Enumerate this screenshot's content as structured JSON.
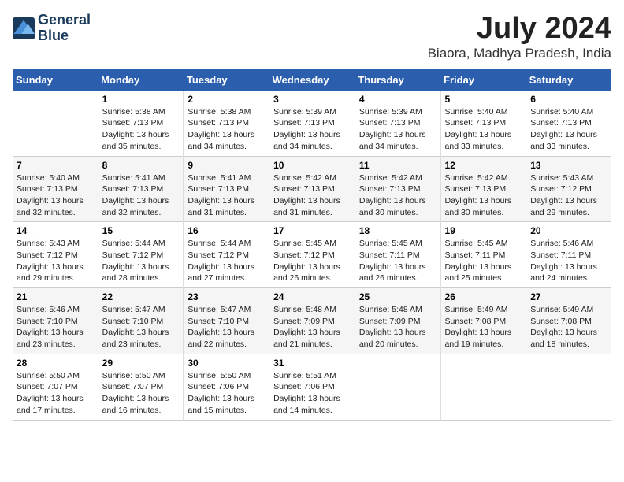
{
  "header": {
    "logo_line1": "General",
    "logo_line2": "Blue",
    "month_year": "July 2024",
    "location": "Biaora, Madhya Pradesh, India"
  },
  "weekdays": [
    "Sunday",
    "Monday",
    "Tuesday",
    "Wednesday",
    "Thursday",
    "Friday",
    "Saturday"
  ],
  "weeks": [
    [
      {
        "day": "",
        "info": ""
      },
      {
        "day": "1",
        "info": "Sunrise: 5:38 AM\nSunset: 7:13 PM\nDaylight: 13 hours\nand 35 minutes."
      },
      {
        "day": "2",
        "info": "Sunrise: 5:38 AM\nSunset: 7:13 PM\nDaylight: 13 hours\nand 34 minutes."
      },
      {
        "day": "3",
        "info": "Sunrise: 5:39 AM\nSunset: 7:13 PM\nDaylight: 13 hours\nand 34 minutes."
      },
      {
        "day": "4",
        "info": "Sunrise: 5:39 AM\nSunset: 7:13 PM\nDaylight: 13 hours\nand 34 minutes."
      },
      {
        "day": "5",
        "info": "Sunrise: 5:40 AM\nSunset: 7:13 PM\nDaylight: 13 hours\nand 33 minutes."
      },
      {
        "day": "6",
        "info": "Sunrise: 5:40 AM\nSunset: 7:13 PM\nDaylight: 13 hours\nand 33 minutes."
      }
    ],
    [
      {
        "day": "7",
        "info": "Sunrise: 5:40 AM\nSunset: 7:13 PM\nDaylight: 13 hours\nand 32 minutes."
      },
      {
        "day": "8",
        "info": "Sunrise: 5:41 AM\nSunset: 7:13 PM\nDaylight: 13 hours\nand 32 minutes."
      },
      {
        "day": "9",
        "info": "Sunrise: 5:41 AM\nSunset: 7:13 PM\nDaylight: 13 hours\nand 31 minutes."
      },
      {
        "day": "10",
        "info": "Sunrise: 5:42 AM\nSunset: 7:13 PM\nDaylight: 13 hours\nand 31 minutes."
      },
      {
        "day": "11",
        "info": "Sunrise: 5:42 AM\nSunset: 7:13 PM\nDaylight: 13 hours\nand 30 minutes."
      },
      {
        "day": "12",
        "info": "Sunrise: 5:42 AM\nSunset: 7:13 PM\nDaylight: 13 hours\nand 30 minutes."
      },
      {
        "day": "13",
        "info": "Sunrise: 5:43 AM\nSunset: 7:12 PM\nDaylight: 13 hours\nand 29 minutes."
      }
    ],
    [
      {
        "day": "14",
        "info": "Sunrise: 5:43 AM\nSunset: 7:12 PM\nDaylight: 13 hours\nand 29 minutes."
      },
      {
        "day": "15",
        "info": "Sunrise: 5:44 AM\nSunset: 7:12 PM\nDaylight: 13 hours\nand 28 minutes."
      },
      {
        "day": "16",
        "info": "Sunrise: 5:44 AM\nSunset: 7:12 PM\nDaylight: 13 hours\nand 27 minutes."
      },
      {
        "day": "17",
        "info": "Sunrise: 5:45 AM\nSunset: 7:12 PM\nDaylight: 13 hours\nand 26 minutes."
      },
      {
        "day": "18",
        "info": "Sunrise: 5:45 AM\nSunset: 7:11 PM\nDaylight: 13 hours\nand 26 minutes."
      },
      {
        "day": "19",
        "info": "Sunrise: 5:45 AM\nSunset: 7:11 PM\nDaylight: 13 hours\nand 25 minutes."
      },
      {
        "day": "20",
        "info": "Sunrise: 5:46 AM\nSunset: 7:11 PM\nDaylight: 13 hours\nand 24 minutes."
      }
    ],
    [
      {
        "day": "21",
        "info": "Sunrise: 5:46 AM\nSunset: 7:10 PM\nDaylight: 13 hours\nand 23 minutes."
      },
      {
        "day": "22",
        "info": "Sunrise: 5:47 AM\nSunset: 7:10 PM\nDaylight: 13 hours\nand 23 minutes."
      },
      {
        "day": "23",
        "info": "Sunrise: 5:47 AM\nSunset: 7:10 PM\nDaylight: 13 hours\nand 22 minutes."
      },
      {
        "day": "24",
        "info": "Sunrise: 5:48 AM\nSunset: 7:09 PM\nDaylight: 13 hours\nand 21 minutes."
      },
      {
        "day": "25",
        "info": "Sunrise: 5:48 AM\nSunset: 7:09 PM\nDaylight: 13 hours\nand 20 minutes."
      },
      {
        "day": "26",
        "info": "Sunrise: 5:49 AM\nSunset: 7:08 PM\nDaylight: 13 hours\nand 19 minutes."
      },
      {
        "day": "27",
        "info": "Sunrise: 5:49 AM\nSunset: 7:08 PM\nDaylight: 13 hours\nand 18 minutes."
      }
    ],
    [
      {
        "day": "28",
        "info": "Sunrise: 5:50 AM\nSunset: 7:07 PM\nDaylight: 13 hours\nand 17 minutes."
      },
      {
        "day": "29",
        "info": "Sunrise: 5:50 AM\nSunset: 7:07 PM\nDaylight: 13 hours\nand 16 minutes."
      },
      {
        "day": "30",
        "info": "Sunrise: 5:50 AM\nSunset: 7:06 PM\nDaylight: 13 hours\nand 15 minutes."
      },
      {
        "day": "31",
        "info": "Sunrise: 5:51 AM\nSunset: 7:06 PM\nDaylight: 13 hours\nand 14 minutes."
      },
      {
        "day": "",
        "info": ""
      },
      {
        "day": "",
        "info": ""
      },
      {
        "day": "",
        "info": ""
      }
    ]
  ]
}
